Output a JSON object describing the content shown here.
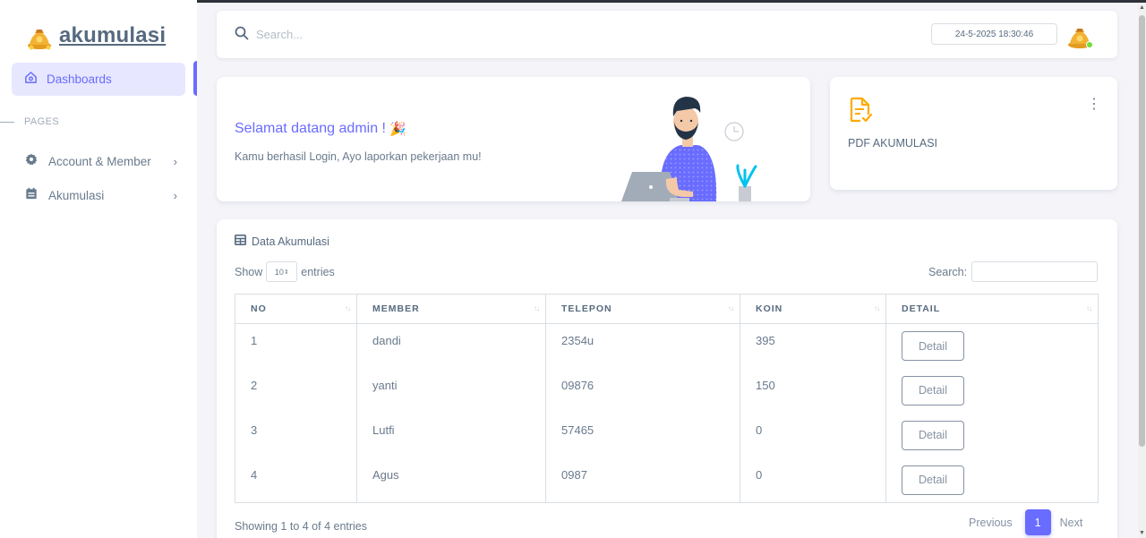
{
  "app": {
    "brand": "akumulasi"
  },
  "sidebar": {
    "active_item": {
      "label": "Dashboards",
      "icon": "home-icon"
    },
    "section_header": "PAGES",
    "items": [
      {
        "label": "Account & Member",
        "icon": "gear-icon"
      },
      {
        "label": "Akumulasi",
        "icon": "calendar-icon"
      }
    ]
  },
  "navbar": {
    "search_placeholder": "Search...",
    "datetime": "24-5-2025 18:30:46"
  },
  "welcome": {
    "title": "Selamat datang admin !",
    "emoji": "🎉",
    "message": "Kamu berhasil Login, Ayo laporkan pekerjaan mu!"
  },
  "pdf_card": {
    "title": "PDF AKUMULASI",
    "icon": "document-check-icon"
  },
  "table_card": {
    "title": "Data Akumulasi",
    "show_label": "Show",
    "page_length": "10",
    "entries_label": "entries",
    "search_label": "Search:",
    "columns": [
      "NO",
      "MEMBER",
      "TELEPON",
      "KOIN",
      "DETAIL"
    ],
    "rows": [
      {
        "no": "1",
        "member": "dandi",
        "telepon": "2354u",
        "koin": "395",
        "detail": "Detail"
      },
      {
        "no": "2",
        "member": "yanti",
        "telepon": "09876",
        "koin": "150",
        "detail": "Detail"
      },
      {
        "no": "3",
        "member": "Lutfi",
        "telepon": "57465",
        "koin": "0",
        "detail": "Detail"
      },
      {
        "no": "4",
        "member": "Agus",
        "telepon": "0987",
        "koin": "0",
        "detail": "Detail"
      }
    ],
    "info": "Showing 1 to 4 of 4 entries",
    "pagination": {
      "previous": "Previous",
      "current": "1",
      "next": "Next"
    }
  },
  "colors": {
    "primary": "#696cff",
    "text": "#697a8d",
    "heading": "#566a7f",
    "background": "#f5f5f9"
  }
}
